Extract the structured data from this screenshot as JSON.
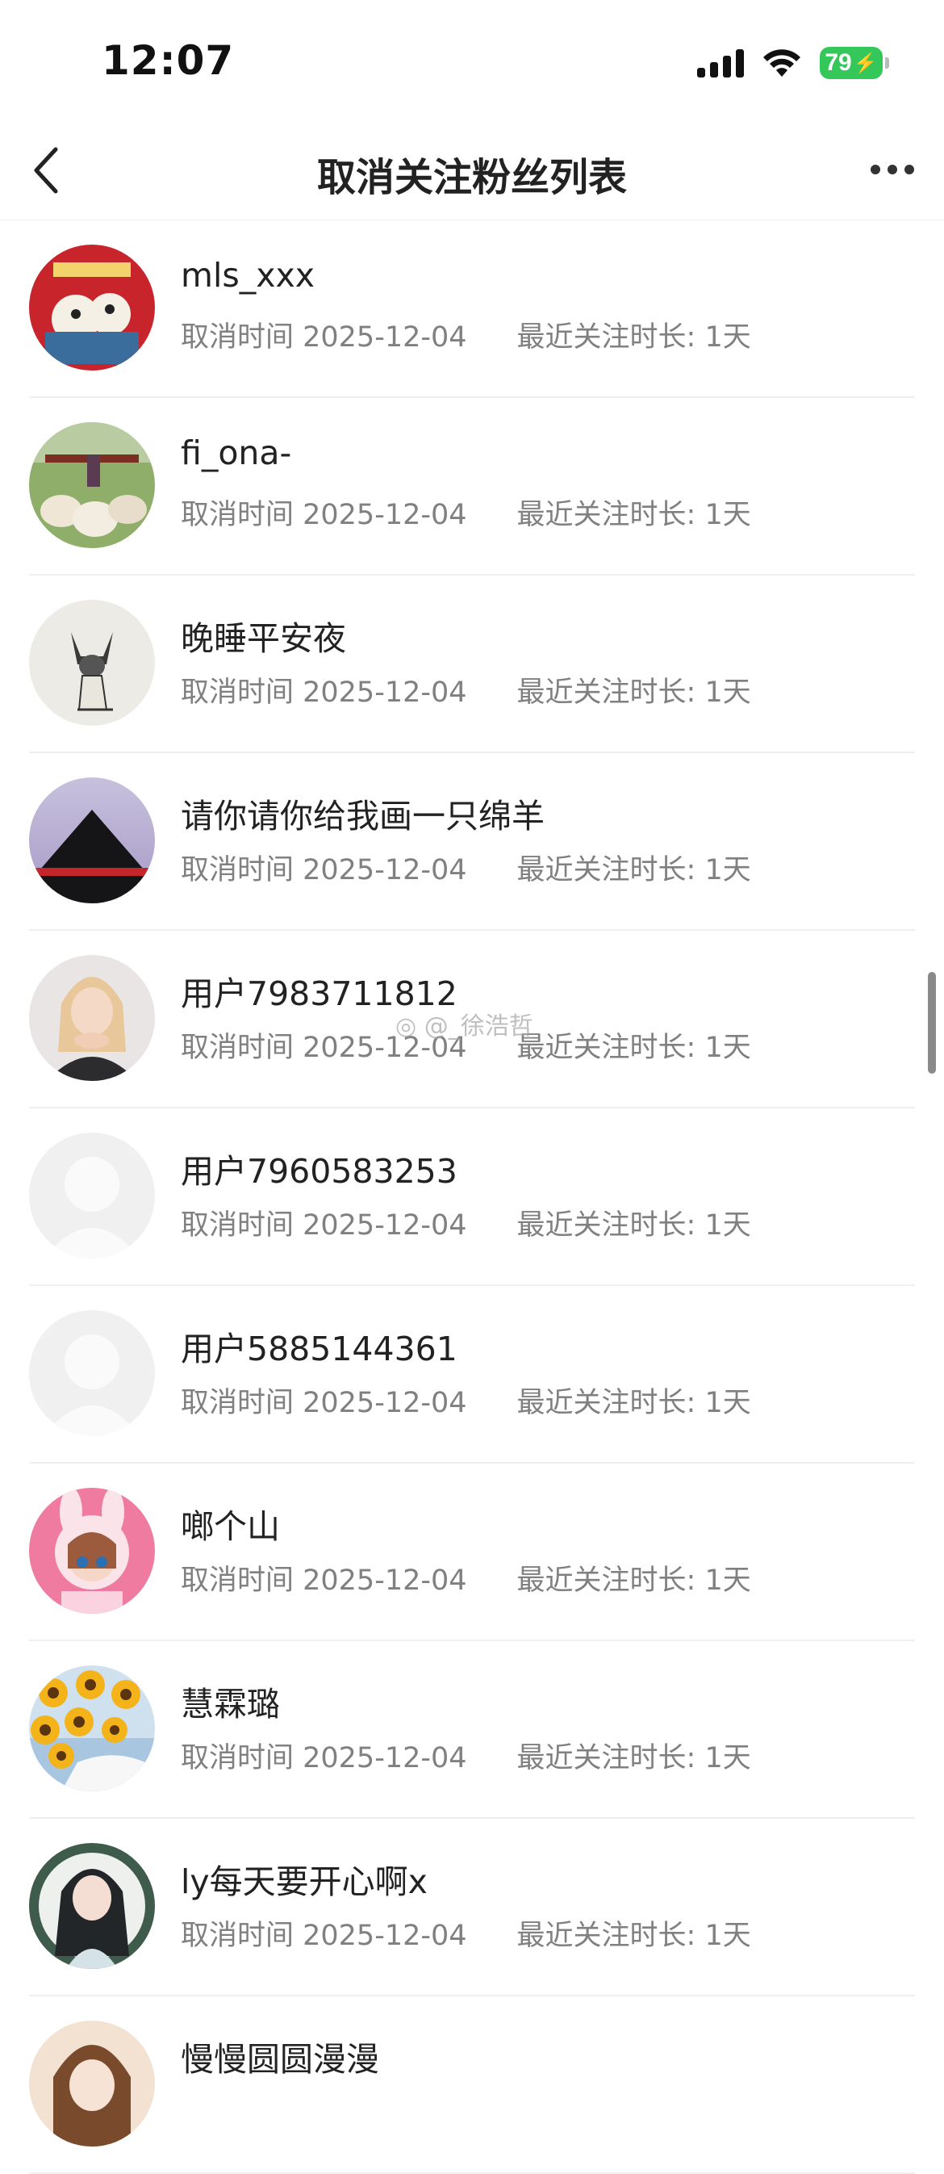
{
  "status_bar": {
    "time": "12:07",
    "battery": "79",
    "icons": [
      "signal-icon",
      "wifi-icon",
      "battery-charging-icon"
    ]
  },
  "nav": {
    "title": "取消关注粉丝列表",
    "back_icon": "chevron-left-icon",
    "more_icon": "more-dots-icon"
  },
  "watermark": "@_徐浩哲",
  "colors": {
    "battery": "#34c759",
    "meta_text": "#808080",
    "divider": "#efefef"
  },
  "followers": [
    {
      "name": "mls_xxx",
      "cancel_time": "取消时间 2025-12-04",
      "duration": "最近关注时长: 1天",
      "avatar": "cartoon-new-year-avatar"
    },
    {
      "name": "fi_ona-",
      "cancel_time": "取消时间 2025-12-04",
      "duration": "最近关注时长: 1天",
      "avatar": "sheep-farm-photo-avatar"
    },
    {
      "name": "晚睡平安夜",
      "cancel_time": "取消时间 2025-12-04",
      "duration": "最近关注时长: 1天",
      "avatar": "siamese-cat-sketch-avatar"
    },
    {
      "name": "请你请你给我画一只绵羊",
      "cancel_time": "取消时间 2025-12-04",
      "duration": "最近关注时长: 1天",
      "avatar": "dark-mountain-avatar"
    },
    {
      "name": "用户7983711812",
      "cancel_time": "取消时间 2025-12-04",
      "duration": "最近关注时长: 1天",
      "avatar": "blonde-girl-photo-avatar"
    },
    {
      "name": "用户7960583253",
      "cancel_time": "取消时间 2025-12-04",
      "duration": "最近关注时长: 1天",
      "avatar": "default-user-avatar"
    },
    {
      "name": "用户5885144361",
      "cancel_time": "取消时间 2025-12-04",
      "duration": "最近关注时长: 1天",
      "avatar": "default-user-avatar"
    },
    {
      "name": "啷个山",
      "cancel_time": "取消时间 2025-12-04",
      "duration": "最近关注时长: 1天",
      "avatar": "bunny-girl-anime-avatar"
    },
    {
      "name": "慧霖璐",
      "cancel_time": "取消时间 2025-12-04",
      "duration": "最近关注时长: 1天",
      "avatar": "sunflowers-avatar"
    },
    {
      "name": "ly每天要开心啊x",
      "cancel_time": "取消时间 2025-12-04",
      "duration": "最近关注时长: 1天",
      "avatar": "illustrated-girl-avatar"
    },
    {
      "name": "慢慢圆圆漫漫",
      "cancel_time": "",
      "duration": "",
      "avatar": "anime-avatar"
    }
  ]
}
